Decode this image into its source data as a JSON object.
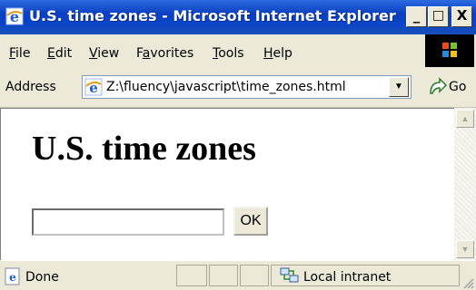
{
  "window": {
    "title": "U.S. time zones - Microsoft Internet Explorer",
    "minimize_label": "_",
    "maximize_label": "□",
    "close_label": "X"
  },
  "menubar": {
    "items": [
      {
        "label": "File",
        "key": "F",
        "rest": "ile"
      },
      {
        "label": "Edit",
        "key": "E",
        "rest": "dit"
      },
      {
        "label": "View",
        "key": "V",
        "rest": "iew"
      },
      {
        "label": "Favorites",
        "pre": "F",
        "key": "a",
        "rest": "vorites"
      },
      {
        "label": "Tools",
        "key": "T",
        "rest": "ools"
      },
      {
        "label": "Help",
        "key": "H",
        "rest": "elp"
      }
    ]
  },
  "address": {
    "label": "Address",
    "url": "Z:\\fluency\\javascript\\time_zones.html",
    "go_label": "Go"
  },
  "page": {
    "heading": "U.S. time zones",
    "input_value": "",
    "ok_label": "OK"
  },
  "status": {
    "text": "Done",
    "zone": "Local intranet"
  },
  "colors": {
    "titlebar": "#0a44c8",
    "chrome": "#ece9d8",
    "content_bg": "#ffffff"
  }
}
